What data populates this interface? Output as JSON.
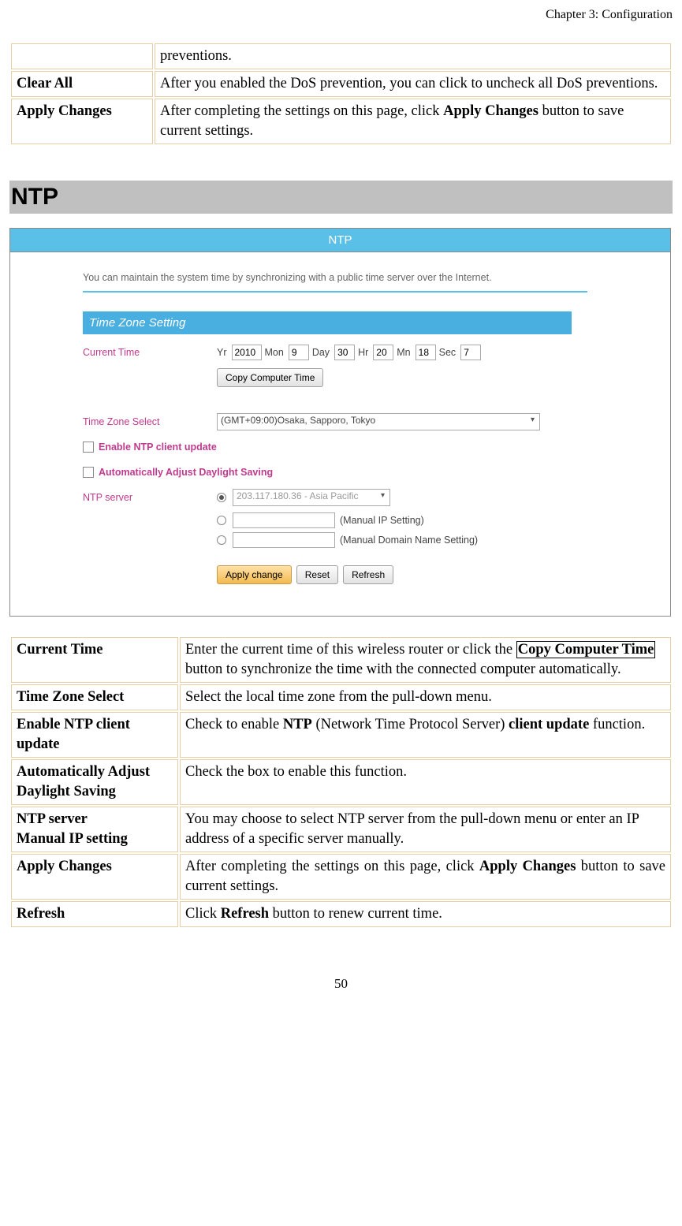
{
  "chapter_header": "Chapter 3: Configuration",
  "page_number": "50",
  "table_top": {
    "rows": [
      {
        "key": "",
        "desc": "preventions."
      },
      {
        "key": "Clear All",
        "desc": "After you enabled the DoS prevention, you can click to uncheck all DoS preventions."
      },
      {
        "key": "Apply Changes",
        "desc_pre": "After completing the settings on this page, click ",
        "desc_bold": "Apply Changes",
        "desc_post": " button to save current settings."
      }
    ]
  },
  "section_title": "NTP",
  "panel": {
    "title": "NTP",
    "intro": "You can maintain the system time by synchronizing with a public time server over the Internet.",
    "tz_header": "Time Zone Setting",
    "current_time_label": "Current Time",
    "yr_lbl": "Yr",
    "yr_val": "2010",
    "mon_lbl": "Mon",
    "mon_val": "9",
    "day_lbl": "Day",
    "day_val": "30",
    "hr_lbl": "Hr",
    "hr_val": "20",
    "mn_lbl": "Mn",
    "mn_val": "18",
    "sec_lbl": "Sec",
    "sec_val": "7",
    "copy_btn": "Copy Computer Time",
    "tz_select_label": "Time Zone Select",
    "tz_select_value": "(GMT+09:00)Osaka, Sapporo, Tokyo",
    "enable_ntp_label": "Enable NTP client update",
    "auto_dst_label": "Automatically Adjust Daylight Saving",
    "ntp_server_label": "NTP server",
    "ntp_server_dropdown": "203.117.180.36 - Asia Pacific",
    "manual_ip_label": "(Manual IP Setting)",
    "manual_domain_label": "(Manual Domain Name Setting)",
    "apply_btn": "Apply change",
    "reset_btn": "Reset",
    "refresh_btn": "Refresh"
  },
  "table_bottom": {
    "r1_key": "Current Time",
    "r1_pre": "Enter the current time of this wireless router or click the ",
    "r1_box": "Copy Computer Time",
    "r1_post": " button to synchronize the time with the connected computer automatically.",
    "r2_key": "Time Zone Select",
    "r2_desc": "Select the local time zone from the pull-down menu.",
    "r3_key": "Enable NTP client update",
    "r3_pre": "Check to enable ",
    "r3_b1": "NTP",
    "r3_mid": " (Network Time Protocol Server) ",
    "r3_b2": "client update",
    "r3_post": " function.",
    "r4_key": "Automatically Adjust Daylight Saving",
    "r4_desc": "Check the box to enable this function.",
    "r5_key_l1": "NTP server",
    "r5_key_l2": "Manual IP setting",
    "r5_desc": "You may choose to select NTP server from the pull-down menu or enter an IP address of a specific server manually.",
    "r6_key": "Apply Changes",
    "r6_pre": "After completing the settings on this page, click ",
    "r6_b": "Apply Changes",
    "r6_post": " button to save current settings.",
    "r7_key": "Refresh",
    "r7_pre": "Click ",
    "r7_b": "Refresh",
    "r7_post": " button to renew current time."
  }
}
